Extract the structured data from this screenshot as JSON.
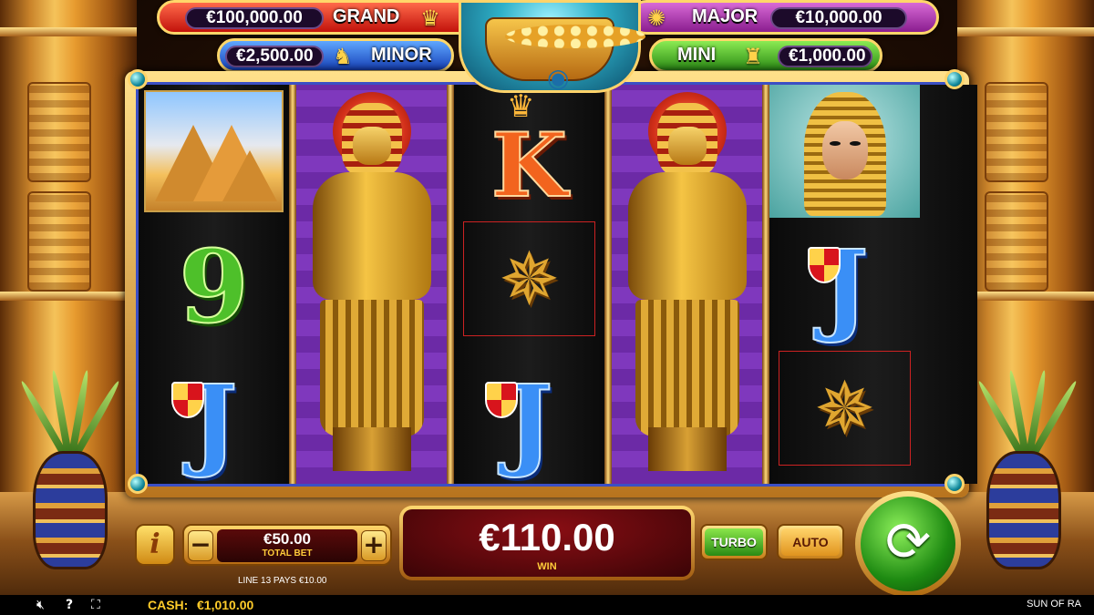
{
  "jackpots": {
    "grand": {
      "label": "GRAND",
      "value": "€100,000.00",
      "icon": "pharaoh-mask-icon"
    },
    "major": {
      "label": "MAJOR",
      "value": "€10,000.00",
      "icon": "scarab-icon"
    },
    "minor": {
      "label": "MINOR",
      "value": "€2,500.00",
      "icon": "cat-icon"
    },
    "mini": {
      "label": "MINI",
      "value": "€1,000.00",
      "icon": "ibis-icon"
    }
  },
  "reels": [
    [
      "pyramids",
      "9",
      "J"
    ],
    [
      "pharaoh-statue"
    ],
    [
      "K",
      "scorpion",
      "J"
    ],
    [
      "pharaoh-statue"
    ],
    [
      "queen",
      "J",
      "scorpion"
    ]
  ],
  "symbols": {
    "nine": "9",
    "jack": "J",
    "king": "K"
  },
  "controls": {
    "info_label": "i",
    "minus_label": "−",
    "plus_label": "+",
    "total_bet_value": "€50.00",
    "total_bet_label": "TOTAL BET",
    "win_value": "€110.00",
    "win_label": "WIN",
    "turbo_label": "TURBO",
    "auto_label": "AUTO",
    "spin_glyph": "⟳"
  },
  "line_pays": "LINE 13 PAYS €10.00",
  "status": {
    "cash_label": "CASH:",
    "cash_value": "€1,010.00",
    "game_name": "SUN OF RA",
    "icons": [
      "mute-icon",
      "help-icon",
      "fullscreen-icon"
    ]
  },
  "colors": {
    "grand": "#c2120b",
    "major": "#8a1d8f",
    "minor": "#1640b8",
    "mini": "#2a8a14",
    "cash": "#ffcc2a"
  }
}
